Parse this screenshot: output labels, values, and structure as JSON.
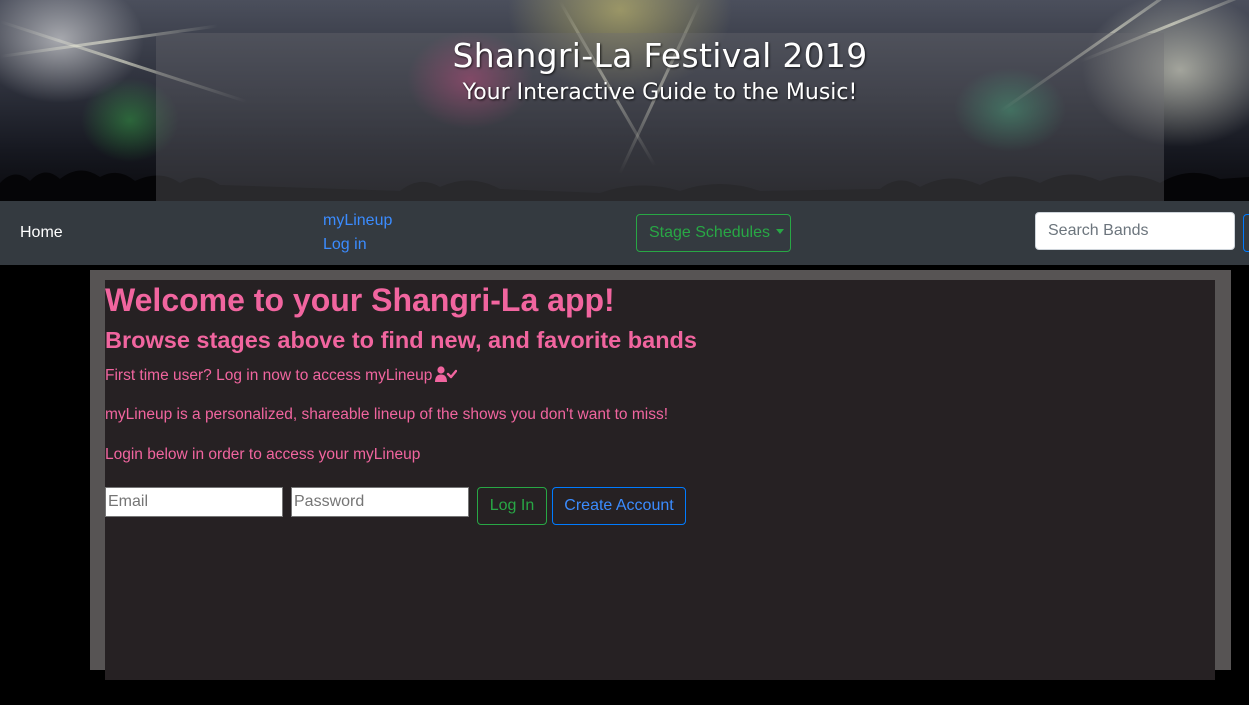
{
  "hero": {
    "title": "Shangri-La Festival 2019",
    "subtitle": "Your Interactive Guide to the Music!"
  },
  "navbar": {
    "home": "Home",
    "mylineup": "myLineup",
    "login": "Log in",
    "stage_schedules": "Stage Schedules",
    "search_placeholder": "Search Bands"
  },
  "main": {
    "heading": "Welcome to your Shangri-La app!",
    "subheading": "Browse stages above to find new, and favorite bands",
    "first_time": "First time user? Log in now to access myLineup",
    "description": "myLineup is a personalized, shareable lineup of the shows you don't want to miss!",
    "login_prompt": "Login below in order to access your myLineup",
    "email_placeholder": "Email",
    "password_placeholder": "Password",
    "login_button": "Log In",
    "create_button": "Create Account"
  },
  "colors": {
    "accent_pink": "#f1659f",
    "success_green": "#28a745",
    "primary_blue": "#007bff",
    "navbar_bg": "#343a40",
    "panel_bg": "#262123"
  }
}
